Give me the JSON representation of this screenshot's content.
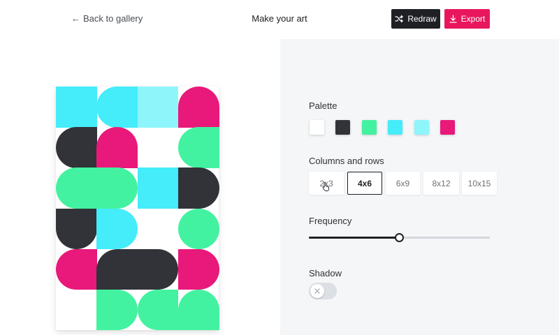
{
  "header": {
    "back_label": "Back to gallery",
    "title": "Make your art",
    "redraw_label": "Redraw",
    "export_label": "Export"
  },
  "icons": {
    "back": "arrow-left-icon",
    "redraw": "shuffle-icon",
    "export": "download-icon",
    "toggle": "close-icon",
    "cursor": "hand-pointer-icon"
  },
  "colors": {
    "dark": "#313338",
    "accent": "#e8175d",
    "redraw_button": "#1f2024",
    "panel_bg": "#f4f6f7"
  },
  "palette": {
    "label": "Palette",
    "swatches": [
      "#ffffff",
      "#313338",
      "#43f2a0",
      "#45ecfa",
      "#8ef6fb",
      "#e8197a"
    ]
  },
  "grid_size": {
    "label": "Columns and rows",
    "options": [
      "2x3",
      "4x6",
      "6x9",
      "8x12",
      "10x15"
    ],
    "selected": "4x6"
  },
  "frequency": {
    "label": "Frequency",
    "value": 0.5
  },
  "shadow": {
    "label": "Shadow",
    "enabled": false
  },
  "artwork": {
    "columns": 4,
    "rows": 6,
    "tiles": [
      {
        "c": 0,
        "r": 0,
        "color": "#45ecfa",
        "shape": "square"
      },
      {
        "c": 1,
        "r": 0,
        "color": "#45ecfa",
        "shape": "round-left"
      },
      {
        "c": 2,
        "r": 0,
        "color": "#8ef6fb",
        "shape": "square"
      },
      {
        "c": 3,
        "r": 0,
        "color": "#e8197a",
        "shape": "round-top"
      },
      {
        "c": 0,
        "r": 1,
        "color": "#313338",
        "shape": "round-left"
      },
      {
        "c": 1,
        "r": 1,
        "color": "#e8197a",
        "shape": "round-top"
      },
      {
        "c": 3,
        "r": 1,
        "color": "#43f2a0",
        "shape": "round-left"
      },
      {
        "c": 0,
        "r": 2,
        "color": "#43f2a0",
        "shape": "round-left"
      },
      {
        "c": 1,
        "r": 2,
        "color": "#43f2a0",
        "shape": "round-right"
      },
      {
        "c": 2,
        "r": 2,
        "color": "#45ecfa",
        "shape": "square"
      },
      {
        "c": 3,
        "r": 2,
        "color": "#313338",
        "shape": "round-right"
      },
      {
        "c": 0,
        "r": 3,
        "color": "#313338",
        "shape": "round-bottom"
      },
      {
        "c": 1,
        "r": 3,
        "color": "#45ecfa",
        "shape": "round-right"
      },
      {
        "c": 3,
        "r": 3,
        "color": "#43f2a0",
        "shape": "circle"
      },
      {
        "c": 0,
        "r": 4,
        "color": "#e8197a",
        "shape": "round-left"
      },
      {
        "c": 1,
        "r": 4,
        "color": "#313338",
        "shape": "round-tl"
      },
      {
        "c": 2,
        "r": 4,
        "color": "#313338",
        "shape": "round-right"
      },
      {
        "c": 3,
        "r": 4,
        "color": "#e8197a",
        "shape": "round-right"
      },
      {
        "c": 1,
        "r": 5,
        "color": "#43f2a0",
        "shape": "round-right"
      },
      {
        "c": 2,
        "r": 5,
        "color": "#43f2a0",
        "shape": "round-left"
      },
      {
        "c": 3,
        "r": 5,
        "color": "#43f2a0",
        "shape": "round-top"
      }
    ]
  }
}
